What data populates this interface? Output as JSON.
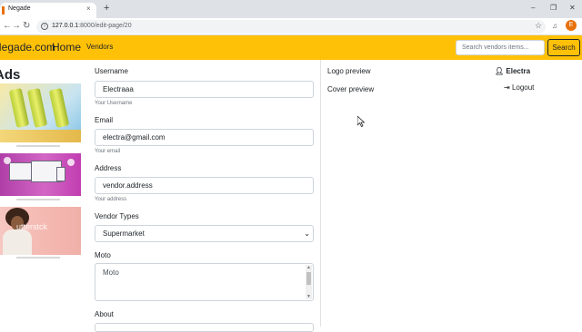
{
  "browser": {
    "tab_title": "Negade",
    "url_host": "127.0.0.1",
    "url_path": ":8000/edit-page/20",
    "profile_initial": "E",
    "nav": {
      "back": "←",
      "forward": "→",
      "reload": "↻",
      "new_tab": "+",
      "close_tab": "×"
    },
    "window": {
      "minimize": "–",
      "restore": "❐",
      "close": "✕"
    },
    "star": "☆",
    "media": "♫"
  },
  "navbar": {
    "brand": "Negade.com",
    "home": "Home",
    "vendors": "Vendors",
    "search_placeholder": "Search vendors items...",
    "search_button": "Search"
  },
  "ads": {
    "title": "Ads",
    "watermark": "utterstck"
  },
  "form": {
    "username_label": "Username",
    "username_value": "Electraaa",
    "username_help": "Your Username",
    "email_label": "Email",
    "email_value": "electra@gmail.com",
    "email_help": "Your email",
    "address_label": "Address",
    "address_value": "vendor.address",
    "address_help": "Your address",
    "vendor_types_label": "Vendor Types",
    "vendor_types_value": "Supermarket",
    "moto_label": "Moto",
    "moto_value": "Moto",
    "about_label": "About"
  },
  "previews": {
    "logo": "Logo preview",
    "cover": "Cover preview"
  },
  "user": {
    "name": "Electra",
    "logout": "Logout"
  },
  "icons": {
    "user": "user-icon",
    "logout": "sign-out-icon",
    "select": "chevron-down-icon"
  },
  "colors": {
    "navbar": "#ffc107",
    "profile": "#e8710a"
  }
}
